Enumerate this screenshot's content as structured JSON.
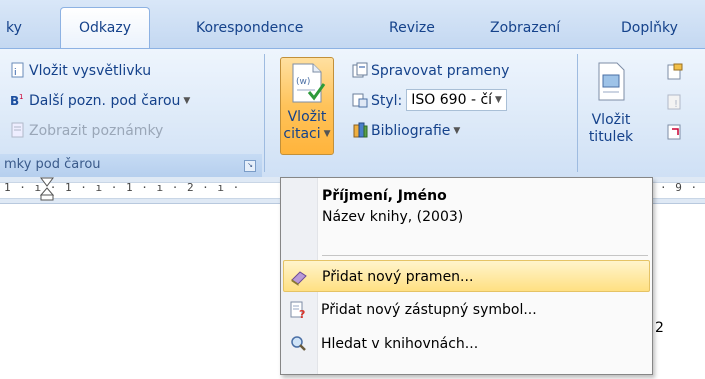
{
  "tabs": [
    {
      "label": "ky"
    },
    {
      "label": "Odkazy",
      "active": true
    },
    {
      "label": "Korespondence"
    },
    {
      "label": "Revize"
    },
    {
      "label": "Zobrazení"
    },
    {
      "label": "Doplňky"
    }
  ],
  "footnotes_group": {
    "insert_endnote": "Vložit vysvětlivku",
    "next_footnote": "Další pozn. pod čarou",
    "show_notes": "Zobrazit poznámky",
    "footer_label": "mky pod čarou"
  },
  "citations_group": {
    "insert_citation_line1": "Vložit",
    "insert_citation_line2": "citaci",
    "manage_sources": "Spravovat prameny",
    "style_label": "Styl:",
    "style_value": "ISO 690 - čí",
    "bibliography": "Bibliografie"
  },
  "captions_group": {
    "insert_caption_line1": "Vložit",
    "insert_caption_line2": "titulek"
  },
  "ruler": {
    "left_text": "1 · ı · 1 · ı · 1 · ı · 2 · ı ·",
    "right_text": "· 9 ·"
  },
  "citation_menu": {
    "source_author": "Příjmení, Jméno",
    "source_title": "Název knihy, (2003)",
    "add_source": "Přidat nový pramen...",
    "add_placeholder": "Přidat nový zástupný symbol...",
    "search_libraries": "Hledat v knihovnách..."
  },
  "document": {
    "visible_letter": "2"
  },
  "colors": {
    "ribbon_text": "#15428b",
    "highlight": "#ffe082"
  }
}
